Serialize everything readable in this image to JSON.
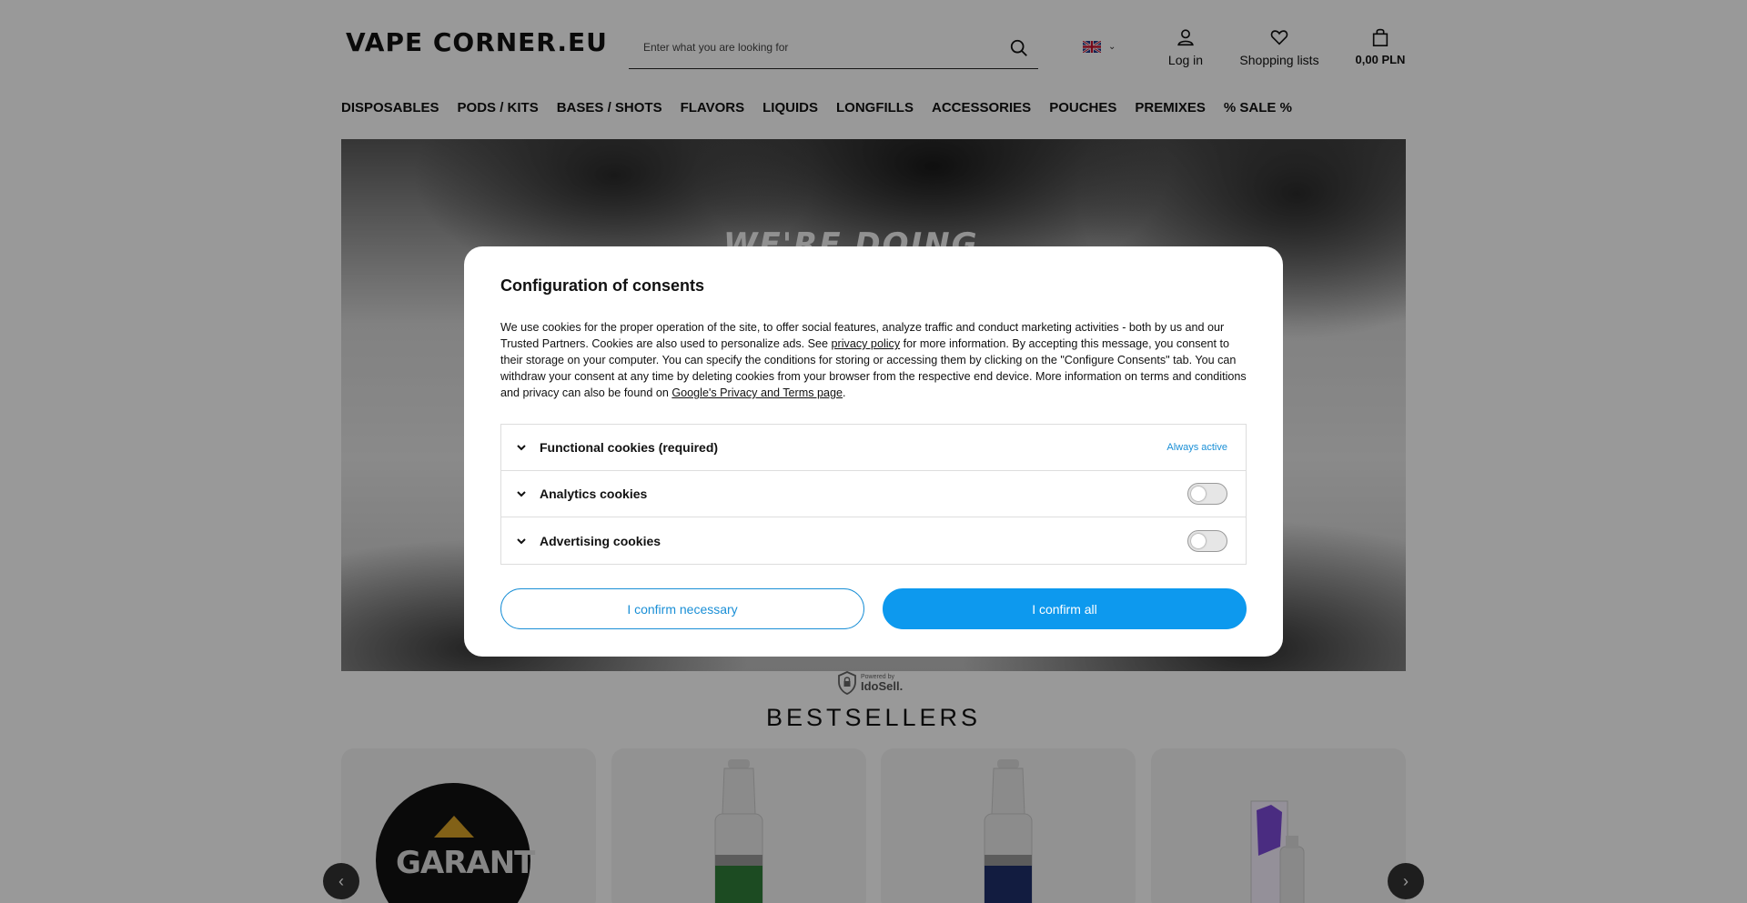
{
  "header": {
    "logo": "VAPE CORNER.EU",
    "search_placeholder": "Enter what you are looking for",
    "login_label": "Log in",
    "lists_label": "Shopping lists",
    "cart_total": "0,00 PLN"
  },
  "nav": {
    "items": [
      {
        "label": "DISPOSABLES"
      },
      {
        "label": "PODS / KITS"
      },
      {
        "label": "BASES / SHOTS"
      },
      {
        "label": "FLAVORS"
      },
      {
        "label": "LIQUIDS"
      },
      {
        "label": "LONGFILLS"
      },
      {
        "label": "ACCESSORIES"
      },
      {
        "label": "POUCHES"
      },
      {
        "label": "PREMIXES"
      },
      {
        "label": "% SALE %"
      }
    ]
  },
  "hero": {
    "text": "WE'RE DOING"
  },
  "powered": {
    "line1": "Powered by",
    "line2": "IdoSell."
  },
  "bestsellers": {
    "title": "BESTSELLERS",
    "card1_brand": "GARANT",
    "arrow_prev": "‹",
    "arrow_next": "›"
  },
  "modal": {
    "title": "Configuration of consents",
    "text_part1": "We use cookies for the proper operation of the site, to offer social features, analyze traffic and conduct marketing activities - both by us and our Trusted Partners. Cookies are also used to personalize ads. See ",
    "privacy_link": "privacy policy",
    "text_part2": " for more information. By accepting this message, you consent to their storage on your computer. You can specify the conditions for storing or accessing them by clicking on the \"Configure Consents\" tab. You can withdraw your consent at any time by deleting cookies from your browser from the respective end device. More information on terms and conditions and privacy can also be found on ",
    "google_link": "Google's Privacy and Terms page",
    "text_part3": ".",
    "rows": [
      {
        "label": "Functional cookies (required)",
        "status": "Always active"
      },
      {
        "label": "Analytics cookies"
      },
      {
        "label": "Advertising cookies"
      }
    ],
    "btn_necessary": "I confirm necessary",
    "btn_all": "I confirm all"
  },
  "colors": {
    "accent": "#0d99ee",
    "accent_text": "#1a8fd6"
  },
  "icons": {
    "search": "search-icon",
    "user": "user-icon",
    "heart": "heart-icon",
    "bag": "shopping-bag-icon",
    "flag": "uk-flag-icon",
    "chevron": "chevron-down-icon"
  }
}
